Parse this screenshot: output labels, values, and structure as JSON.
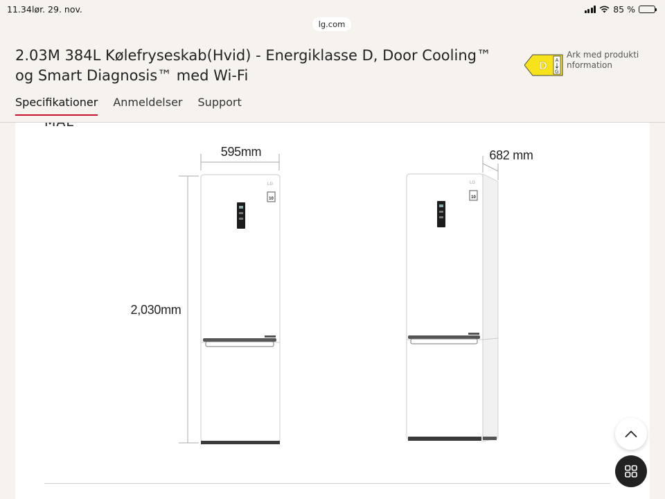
{
  "status_bar": {
    "time": "11.34",
    "date": "lør. 29. nov.",
    "battery": "85 %",
    "battery_level": 0.85
  },
  "browser": {
    "url": "lg.com"
  },
  "product": {
    "title_line1": "2.03M 384L Kølefryseskab(Hvid) - Energiklasse D, Door Cooling™",
    "title_line2": "og Smart Diagnosis™ med Wi-Fi",
    "energy_class": "D",
    "energy_scale_top": "A",
    "energy_scale_bottom": "G",
    "energy_label_color": "#f7e21b",
    "energy_note": "Ark med produktinformation"
  },
  "tabs": [
    {
      "label": "Specifikationer",
      "active": true
    },
    {
      "label": "Anmeldelser",
      "active": false
    },
    {
      "label": "Support",
      "active": false
    }
  ],
  "accent_color": "#c8102e",
  "content": {
    "section_heading": "MÅL",
    "width_label": "595mm",
    "depth_label": "682 mm",
    "height_label": "2,030mm",
    "brand_logo": "LG",
    "inverter_badge": "10"
  },
  "icons": {
    "scroll_up": "chevron-up-icon",
    "menu": "grid-icon"
  }
}
